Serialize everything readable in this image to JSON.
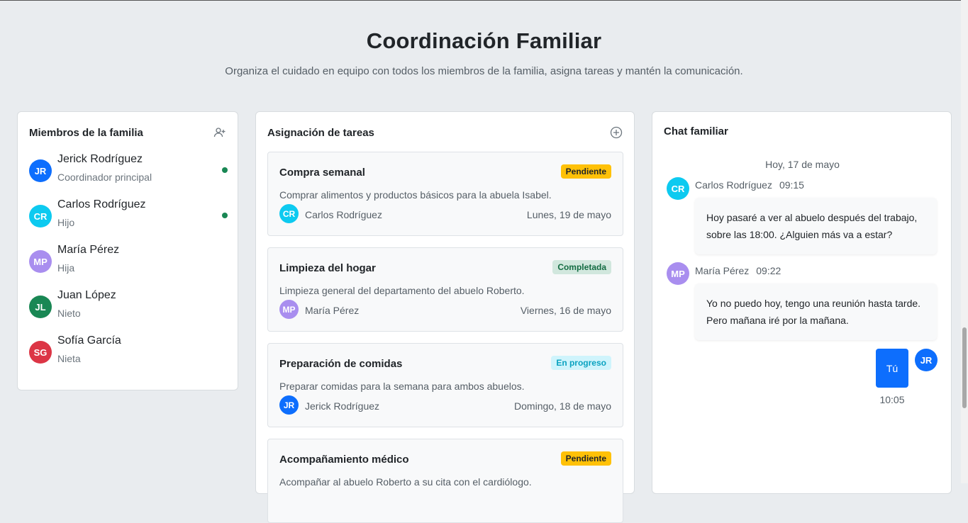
{
  "header": {
    "title": "Coordinación Familiar",
    "subtitle": "Organiza el cuidado en equipo con todos los miembros de la familia, asigna tareas y mantén la comunicación."
  },
  "members": {
    "title": "Miembros de la familia",
    "add_icon": "user-plus-icon",
    "items": [
      {
        "initials": "JR",
        "name": "Jerick Rodríguez",
        "role": "Coordinador principal",
        "color": "#0d6efd",
        "online": true
      },
      {
        "initials": "CR",
        "name": "Carlos Rodríguez",
        "role": "Hijo",
        "color": "#0dcaf0",
        "online": true
      },
      {
        "initials": "MP",
        "name": "María Pérez",
        "role": "Hija",
        "color": "#a98eef",
        "online": false
      },
      {
        "initials": "JL",
        "name": "Juan López",
        "role": "Nieto",
        "color": "#198754",
        "online": false
      },
      {
        "initials": "SG",
        "name": "Sofía García",
        "role": "Nieta",
        "color": "#dc3545",
        "online": false
      }
    ]
  },
  "tasks": {
    "title": "Asignación de tareas",
    "add_icon": "plus-circle-icon",
    "items": [
      {
        "title": "Compra semanal",
        "status": "Pendiente",
        "description": "Comprar alimentos y productos básicos para la abuela Isabel.",
        "assignee_initials": "CR",
        "assignee": "Carlos Rodríguez",
        "date": "Lunes, 19 de mayo"
      },
      {
        "title": "Limpieza del hogar",
        "status": "Completada",
        "description": "Limpieza general del departamento del abuelo Roberto.",
        "assignee_initials": "MP",
        "assignee": "María Pérez",
        "date": "Viernes, 16 de mayo"
      },
      {
        "title": "Preparación de comidas",
        "status": "En progreso",
        "description": "Preparar comidas para la semana para ambos abuelos.",
        "assignee_initials": "JR",
        "assignee": "Jerick Rodríguez",
        "date": "Domingo, 18 de mayo"
      },
      {
        "title": "Acompañamiento médico",
        "status": "Pendiente",
        "description": "Acompañar al abuelo Roberto a su cita con el cardiólogo."
      }
    ]
  },
  "chat": {
    "title": "Chat familiar",
    "date": "Hoy, 17 de mayo",
    "messages": [
      {
        "initials": "CR",
        "author": "Carlos Rodríguez",
        "time": "09:15",
        "text": "Hoy pasaré a ver al abuelo después del trabajo, sobre las 18:00. ¿Alguien más va a estar?"
      },
      {
        "initials": "MP",
        "author": "María Pérez",
        "time": "09:22",
        "text": "Yo no puedo hoy, tengo una reunión hasta tarde. Pero mañana iré por la mañana."
      }
    ],
    "own_message": {
      "initials": "JR",
      "text": "Tú",
      "time": "10:05"
    }
  }
}
